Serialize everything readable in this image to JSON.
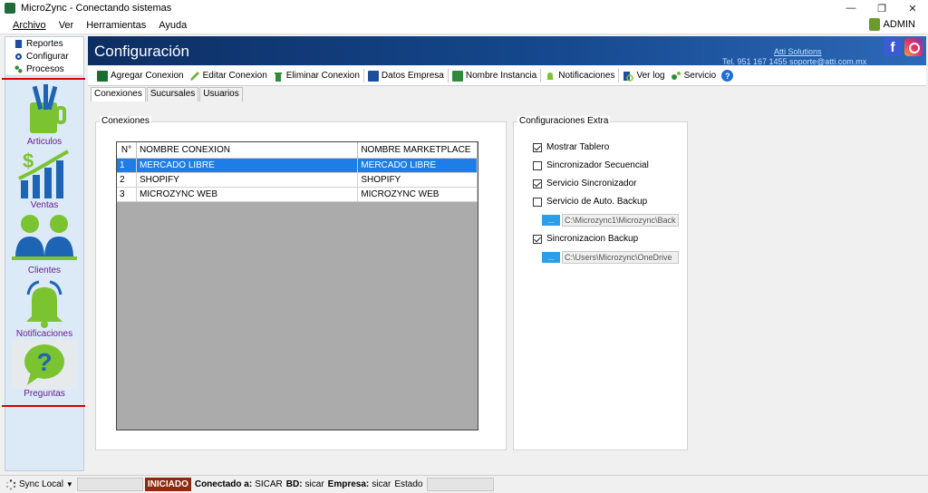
{
  "window": {
    "title": "MicroZync - Conectando sistemas",
    "minimize": "—",
    "restore": "❐",
    "close": "✕"
  },
  "menu": {
    "items": [
      "Archivo",
      "Ver",
      "Herramientas",
      "Ayuda"
    ],
    "user": "ADMIN"
  },
  "nav": {
    "top_items": [
      "Reportes",
      "Configurar",
      "Procesos"
    ],
    "big_items": [
      "Articulos",
      "Ventas",
      "Clientes",
      "Notificaciones",
      "Preguntas"
    ]
  },
  "banner": {
    "title": "Configuración",
    "company": "Atti Solutions",
    "contact": "Tel. 951 167 1455 soporte@atti.com.mx",
    "fb_letter": "f"
  },
  "toolbar": {
    "buttons": [
      "Agregar Conexion",
      "Editar Conexion",
      "Eliminar Conexion",
      "Datos Empresa",
      "Nombre Instancia",
      "Notificaciones",
      "Ver log",
      "Servicio"
    ],
    "help": "?"
  },
  "tabs": [
    "Conexiones",
    "Sucursales",
    "Usuarios"
  ],
  "connections": {
    "legend": "Conexiones",
    "columns": [
      "N°",
      "NOMBRE CONEXION",
      "NOMBRE MARKETPLACE"
    ],
    "rows": [
      [
        "1",
        "MERCADO LIBRE",
        "MERCADO LIBRE"
      ],
      [
        "2",
        "SHOPIFY",
        "SHOPIFY"
      ],
      [
        "3",
        "MICROZYNC WEB",
        "MICROZYNC WEB"
      ]
    ]
  },
  "extra": {
    "legend": "Configuraciones Extra",
    "options": [
      {
        "label": "Mostrar Tablero",
        "checked": true
      },
      {
        "label": "Sincronizador Secuencial",
        "checked": false
      },
      {
        "label": "Servicio Sincronizador",
        "checked": true
      },
      {
        "label": "Servicio de Auto. Backup",
        "checked": false
      },
      {
        "label": "Sincronizacion Backup",
        "checked": true
      }
    ],
    "browse_label": "...",
    "auto_backup_path": "C:\\Microzync1\\Microzync\\Back",
    "sync_backup_path": "C:\\Users\\Microzync\\OneDrive"
  },
  "status": {
    "sync": "Sync Local",
    "state": "INICIADO",
    "connected_label": "Conectado a:",
    "connected_value": "SICAR",
    "bd_label": "BD:",
    "bd_value": "sicar",
    "empresa_label": "Empresa:",
    "empresa_value": "sicar",
    "estado_label": "Estado"
  }
}
